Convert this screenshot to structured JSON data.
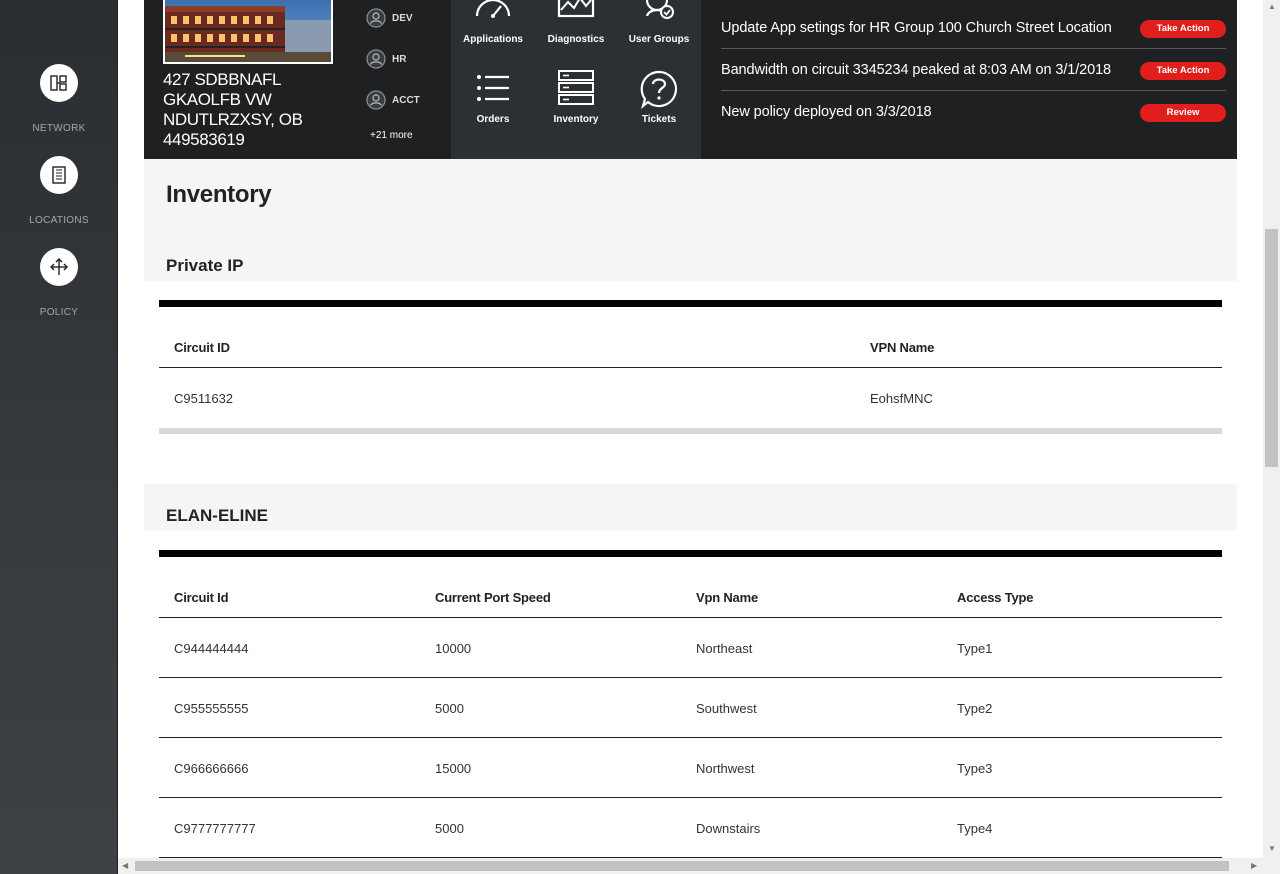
{
  "sidebar": {
    "items": [
      {
        "label": "NETWORK",
        "icon": "network-icon"
      },
      {
        "label": "LOCATIONS",
        "icon": "building-icon"
      },
      {
        "label": "POLICY",
        "icon": "move-arrows-icon"
      }
    ]
  },
  "header": {
    "address": "427 SDBBNAFL GKAOLFB VW NDUTLRZXSY, OB 449583619",
    "groups": [
      {
        "label": "DEV",
        "icon": "user-circle-icon"
      },
      {
        "label": "HR",
        "icon": "user-circle-icon"
      },
      {
        "label": "ACCT",
        "icon": "user-circle-icon"
      }
    ],
    "more_groups": "+21 more",
    "quick_links": [
      {
        "label": "Applications",
        "icon": "gauge-icon"
      },
      {
        "label": "Diagnostics",
        "icon": "pulse-chart-icon"
      },
      {
        "label": "User Groups",
        "icon": "user-group-check-icon"
      },
      {
        "label": "Orders",
        "icon": "list-icon"
      },
      {
        "label": "Inventory",
        "icon": "server-stack-icon"
      },
      {
        "label": "Tickets",
        "icon": "question-bubble-icon"
      }
    ],
    "alerts": [
      {
        "text": "Update App setings for HR Group 100 Church Street Location",
        "action": "Take Action"
      },
      {
        "text": "Bandwidth on circuit 3345234 peaked at 8:03 AM on 3/1/2018",
        "action": "Take Action"
      },
      {
        "text": "New policy deployed on 3/3/2018",
        "action": "Review"
      }
    ]
  },
  "main": {
    "title": "Inventory",
    "private_ip": {
      "title": "Private IP",
      "columns": [
        "Circuit ID",
        "VPN Name"
      ],
      "rows": [
        [
          "C9511632",
          "EohsfMNC"
        ]
      ]
    },
    "elan_eline": {
      "title": "ELAN-ELINE",
      "columns": [
        "Circuit Id",
        "Current Port Speed",
        "Vpn Name",
        "Access Type"
      ],
      "rows": [
        [
          "C944444444",
          "10000",
          "Northeast",
          "Type1"
        ],
        [
          "C955555555",
          "5000",
          "Southwest",
          "Type2"
        ],
        [
          "C966666666",
          "15000",
          "Northwest",
          "Type3"
        ],
        [
          "C9777777777",
          "5000",
          "Downstairs",
          "Type4"
        ]
      ]
    }
  },
  "colors": {
    "accent": "#e01e1b",
    "header_bg": "#1e2022",
    "sidebar_bg": "#33373a"
  }
}
